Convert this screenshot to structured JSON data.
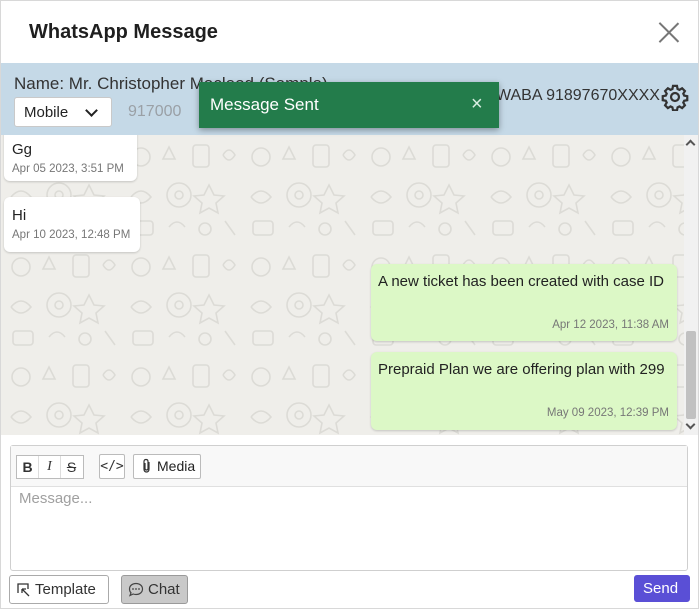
{
  "dialog": {
    "title": "WhatsApp Message"
  },
  "contact": {
    "name_line": "Name: Mr. Christopher Macleod (Sample)",
    "phone_type": "Mobile",
    "phone_number": "917000",
    "waba": "WABA 91897670XXXX"
  },
  "toast": {
    "message": "Message Sent",
    "close_symbol": "×"
  },
  "messages": [
    {
      "direction": "in",
      "text": "Gg",
      "time": "Apr 05 2023, 3:51 PM"
    },
    {
      "direction": "in",
      "text": "Hi",
      "time": "Apr 10 2023, 12:48 PM"
    },
    {
      "direction": "out",
      "text": "A new ticket has been created with case ID",
      "time": "Apr 12 2023, 11:38 AM"
    },
    {
      "direction": "out",
      "text": "Prepraid Plan we are offering plan with 299",
      "time": "May 09 2023, 12:39 PM"
    }
  ],
  "composer": {
    "bold": "B",
    "italic": "I",
    "strike": "S",
    "code": "</>",
    "media_label": "Media",
    "placeholder": "Message..."
  },
  "actions": {
    "template_label": "Template",
    "chat_label": "Chat",
    "send_label": "Send"
  },
  "colors": {
    "info_bar": "#c5d9e7",
    "toast": "#237c4b",
    "outgoing_bubble": "#dcf8c6",
    "send_button": "#5a4fd6"
  }
}
